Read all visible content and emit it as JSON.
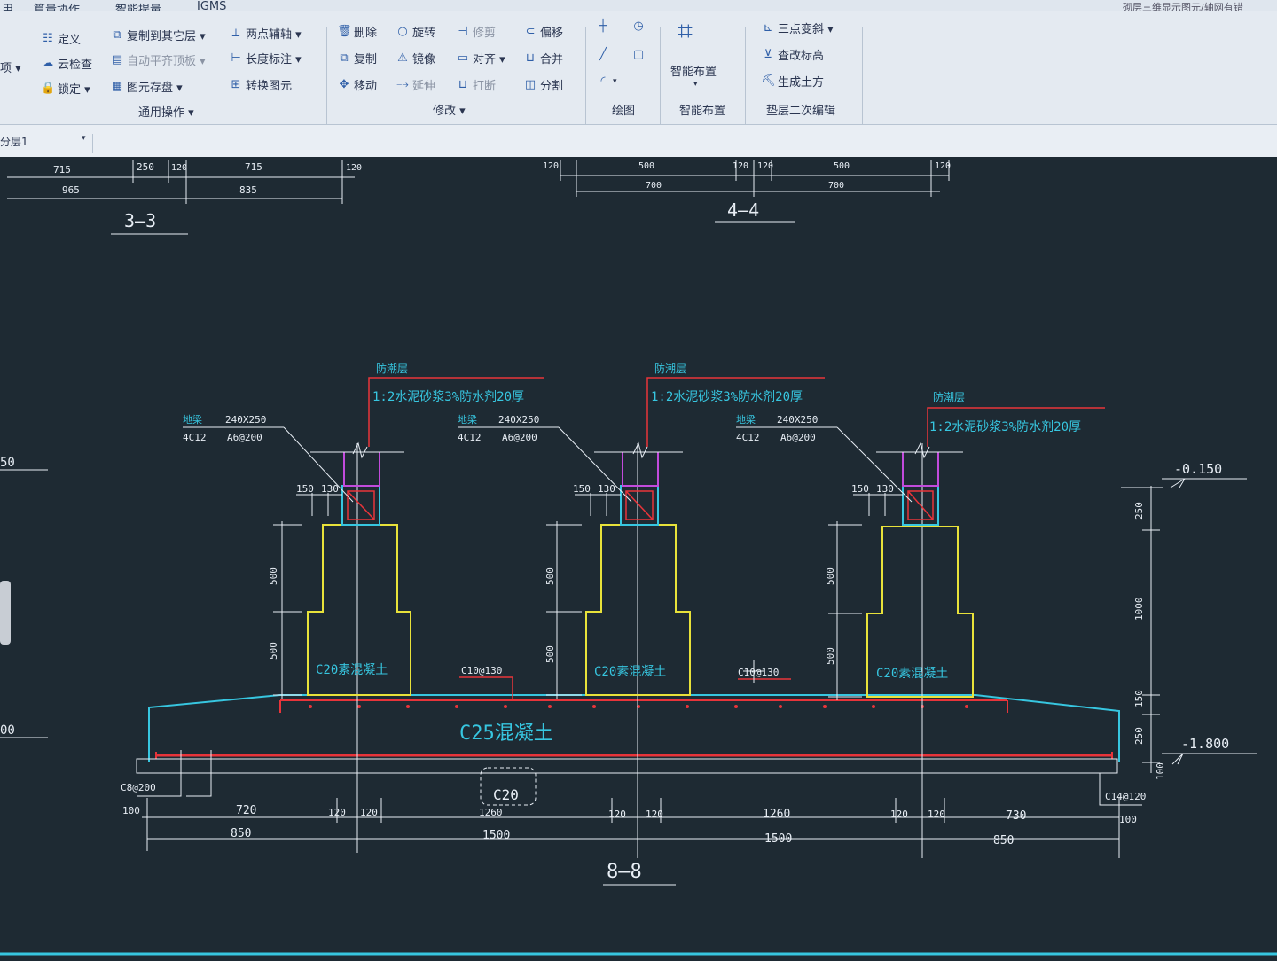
{
  "menu": {
    "items": [
      "用",
      "算量协作",
      "智能提量",
      "IGMS"
    ],
    "title": "砌层三维显示图元/轴网有错"
  },
  "ribbon": {
    "general": {
      "left_clip": [
        "项 ▾"
      ],
      "define": "定义",
      "cloud_check": "云检查",
      "lock": "锁定 ▾",
      "copy_to_floor": "复制到其它层 ▾",
      "auto_flat_slab": "自动平齐顶板 ▾",
      "save_element": "图元存盘 ▾",
      "two_point_axis": "两点辅轴 ▾",
      "length_mark": "长度标注 ▾",
      "convert_element": "转换图元",
      "group": "通用操作 ▾"
    },
    "modify": {
      "delete": "删除",
      "rotate": "旋转",
      "trim": "修剪",
      "offset": "偏移",
      "copy": "复制",
      "mirror": "镜像",
      "align": "对齐 ▾",
      "merge": "合并",
      "move": "移动",
      "extend": "延伸",
      "break": "打断",
      "split": "分割",
      "group": "修改 ▾"
    },
    "draw": {
      "group": "绘图"
    },
    "smart": {
      "label": "智能布置",
      "arrow": "▾",
      "group": "智能布置"
    },
    "cushion": {
      "three_point_slope": "三点变斜 ▾",
      "check_elevation": "查改标高",
      "gen_earthwork": "生成土方",
      "group": "垫层二次编辑"
    }
  },
  "layer": {
    "value": "分层1"
  },
  "drawing": {
    "sec33": {
      "label": "3—3",
      "dims_top": [
        "715",
        "250",
        "120",
        "715",
        "120"
      ],
      "dims_bot": [
        "965",
        "835"
      ]
    },
    "sec44": {
      "label": "4—4",
      "dims_top": [
        "120",
        "500",
        "120",
        "120",
        "500",
        "120"
      ],
      "dims_bot": [
        "700",
        "700"
      ]
    },
    "beam_name": "地梁",
    "beam_size": "240X250",
    "beam_rebar": "4C12",
    "beam_stirrup": "A6@200",
    "moisture_label": "防潮层",
    "moisture_note": "1:2水泥砂浆3%防水剂20厚",
    "dim_150": "150",
    "dim_130": "130",
    "dim_500": "500",
    "concrete_c20": "C20素混凝土",
    "slab_label": "C25混凝土",
    "cushion_label": "C20",
    "rebar_mid": "C10@130",
    "rebar_left": "C8@200",
    "rebar_right": "C14@120",
    "elev_top": "-0.150",
    "elev_bot": "-1.800",
    "right_dims": [
      "250",
      "1000",
      "150",
      "250",
      "100"
    ],
    "bottom_dims1": [
      "100",
      "720",
      "120",
      "120",
      "1260",
      "120",
      "120",
      "1260",
      "120",
      "120",
      "730",
      "100"
    ],
    "bottom_dims2": [
      "850",
      "1500",
      "1500",
      "850"
    ],
    "section_label": "8—8",
    "edge_left_1": "50",
    "edge_left_2": "00"
  },
  "colors": {
    "ribbon_bg": "#e4eaf1",
    "canvas_bg": "#1e2a33",
    "cyan": "#37c6e0",
    "yellow": "#e8e23a",
    "red": "#e8343a",
    "magenta": "#c24bdc",
    "white": "#e8eef5"
  }
}
